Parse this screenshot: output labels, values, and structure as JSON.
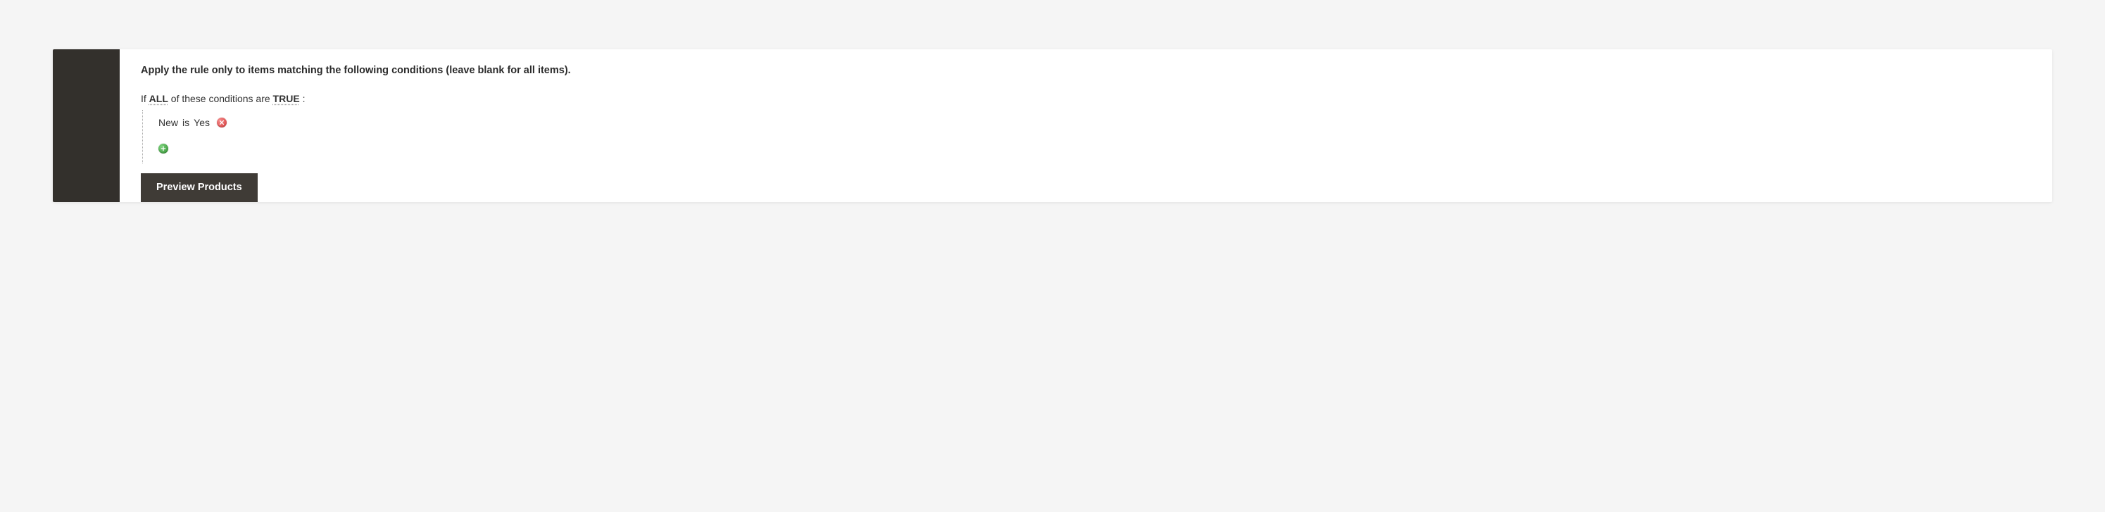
{
  "heading": "Apply the rule only to items matching the following conditions (leave blank for all items).",
  "aggregator": {
    "prefix": "If",
    "all": "ALL",
    "mid": " of these conditions are",
    "value": "TRUE",
    "suffix": ":"
  },
  "conditions": [
    {
      "attribute": "New",
      "operator": "is",
      "value": "Yes"
    }
  ],
  "previewLabel": "Preview Products"
}
